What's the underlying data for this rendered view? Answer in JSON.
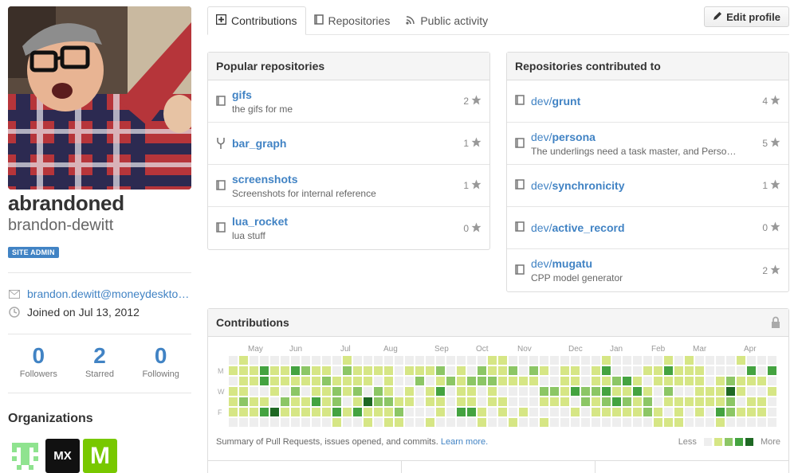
{
  "profile": {
    "fullname": "abrandoned",
    "username": "brandon-dewitt",
    "badge": "SITE ADMIN",
    "email": "brandon.dewitt@moneydeskto…",
    "joined": "Joined on Jul 13, 2012",
    "icons": {
      "email": "mail-icon",
      "joined": "clock-icon"
    }
  },
  "stats": [
    {
      "value": "0",
      "label": "Followers"
    },
    {
      "value": "2",
      "label": "Starred"
    },
    {
      "value": "0",
      "label": "Following"
    }
  ],
  "organizations": {
    "title": "Organizations",
    "items": [
      {
        "label": "",
        "color": "#8fe38f"
      },
      {
        "label": "MX",
        "color": "#111111"
      },
      {
        "label": "M",
        "color": "#78c800"
      }
    ]
  },
  "tabs": [
    {
      "label": "Contributions",
      "icon": "contributions-icon",
      "active": true
    },
    {
      "label": "Repositories",
      "icon": "repo-icon",
      "active": false
    },
    {
      "label": "Public activity",
      "icon": "rss-icon",
      "active": false
    }
  ],
  "edit_profile": "Edit profile",
  "popular": {
    "title": "Popular repositories",
    "repos": [
      {
        "owner": "",
        "name": "gifs",
        "desc": "the gifs for me",
        "stars": "2",
        "icon": "repo"
      },
      {
        "owner": "",
        "name": "bar_graph",
        "desc": "",
        "stars": "1",
        "icon": "fork"
      },
      {
        "owner": "",
        "name": "screenshots",
        "desc": "Screenshots for internal reference",
        "stars": "1",
        "icon": "repo"
      },
      {
        "owner": "",
        "name": "lua_rocket",
        "desc": "lua stuff",
        "stars": "0",
        "icon": "repo"
      }
    ]
  },
  "contributed": {
    "title": "Repositories contributed to",
    "repos": [
      {
        "owner": "dev/",
        "name": "grunt",
        "desc": "",
        "stars": "4",
        "icon": "repo"
      },
      {
        "owner": "dev/",
        "name": "persona",
        "desc": "The underlings need a task master, and Perso…",
        "stars": "5",
        "icon": "repo"
      },
      {
        "owner": "dev/",
        "name": "synchronicity",
        "desc": "",
        "stars": "1",
        "icon": "repo"
      },
      {
        "owner": "dev/",
        "name": "active_record",
        "desc": "",
        "stars": "0",
        "icon": "repo"
      },
      {
        "owner": "dev/",
        "name": "mugatu",
        "desc": "CPP model generator",
        "stars": "2",
        "icon": "repo"
      }
    ]
  },
  "contributions": {
    "title": "Contributions",
    "months": [
      "May",
      "Jun",
      "Jul",
      "Aug",
      "Sep",
      "Oct",
      "Nov",
      "Dec",
      "Jan",
      "Feb",
      "Mar",
      "Apr"
    ],
    "days": [
      "M",
      "W",
      "F"
    ],
    "summary": "Summary of Pull Requests, issues opened, and commits.",
    "learn_more": "Learn more.",
    "legend_less": "Less",
    "legend_more": "More",
    "colors": [
      "#eeeeee",
      "#d6e685",
      "#8cc665",
      "#44a340",
      "#1e6823"
    ]
  }
}
